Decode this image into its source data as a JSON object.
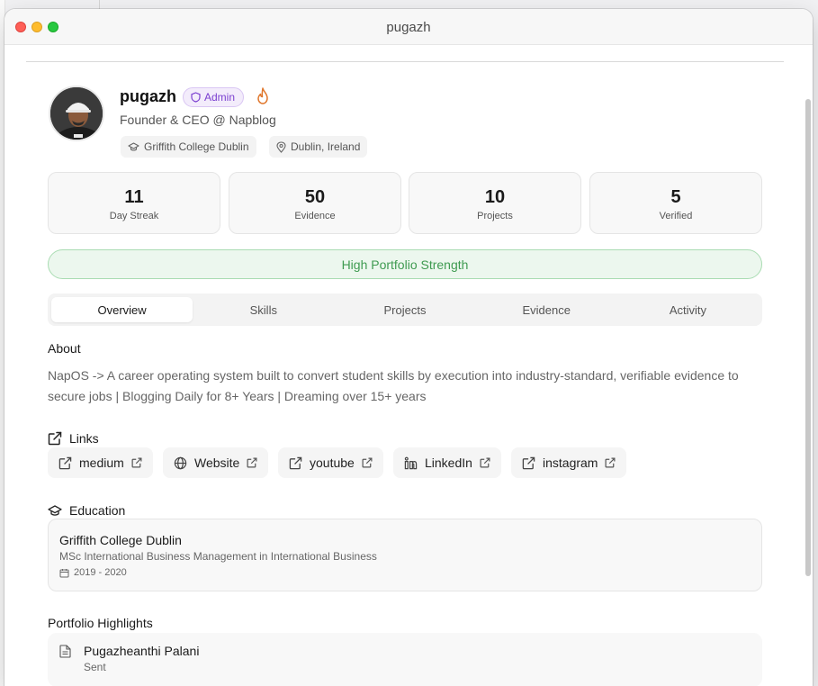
{
  "window": {
    "title": "pugazh"
  },
  "profile": {
    "username": "pugazh",
    "badge": "Admin",
    "headline": "Founder & CEO @ Napblog",
    "school_chip": "Griffith College Dublin",
    "location_chip": "Dublin, Ireland"
  },
  "stats": [
    {
      "value": "11",
      "label": "Day Streak"
    },
    {
      "value": "50",
      "label": "Evidence"
    },
    {
      "value": "10",
      "label": "Projects"
    },
    {
      "value": "5",
      "label": "Verified"
    }
  ],
  "strength": "High Portfolio Strength",
  "tabs": [
    "Overview",
    "Skills",
    "Projects",
    "Evidence",
    "Activity"
  ],
  "active_tab": "Overview",
  "about": {
    "title": "About",
    "text": "NapOS -> A career operating system built to convert student skills by execution into industry-standard, verifiable evidence to secure jobs | Blogging Daily for 8+ Years | Dreaming over 15+ years"
  },
  "links": {
    "title": "Links",
    "items": [
      {
        "label": "medium",
        "icon": "external-link-icon"
      },
      {
        "label": "Website",
        "icon": "globe-icon"
      },
      {
        "label": "youtube",
        "icon": "external-link-icon"
      },
      {
        "label": "LinkedIn",
        "icon": "linkedin-icon"
      },
      {
        "label": "instagram",
        "icon": "external-link-icon"
      }
    ]
  },
  "education": {
    "title": "Education",
    "school": "Griffith College Dublin",
    "degree": "MSc International Business Management in International Business",
    "years": "2019 - 2020"
  },
  "highlights": {
    "title": "Portfolio Highlights",
    "items": [
      {
        "title": "Pugazheanthi Palani",
        "subtitle": "Sent"
      }
    ]
  },
  "colors": {
    "admin_badge": "#7b3fd0",
    "strength_green": "#3f9b51",
    "fire": "#e0762b"
  }
}
